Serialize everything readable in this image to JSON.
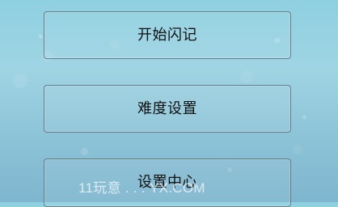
{
  "menu": {
    "items": [
      {
        "label": "开始闪记"
      },
      {
        "label": "难度设置"
      },
      {
        "label": "设置中心"
      }
    ]
  },
  "watermark": {
    "text": "11玩意 . . . YX.COM"
  },
  "colors": {
    "background_top": "#8ed0e1",
    "background_bottom": "#7fb6cf",
    "button_border": "#5a6e78",
    "button_text": "#111111"
  }
}
